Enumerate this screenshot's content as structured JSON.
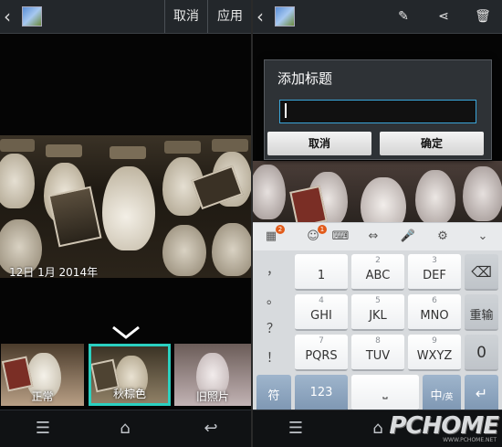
{
  "left_panel": {
    "actionbar": {
      "cancel_label": "取消",
      "apply_label": "应用"
    },
    "photo": {
      "date_text": "12日 1月 2014年"
    },
    "filters": [
      {
        "label": "正常",
        "selected": false
      },
      {
        "label": "秋棕色",
        "selected": true
      },
      {
        "label": "旧照片",
        "selected": false
      }
    ]
  },
  "right_panel": {
    "dialog": {
      "title": "添加标题",
      "input_value": "",
      "cancel_label": "取消",
      "ok_label": "确定"
    },
    "keyboard": {
      "toolbar_badges": {
        "apps": "2",
        "emoji": "1"
      },
      "symbols": [
        "，",
        "。",
        "？",
        "！"
      ],
      "rows": [
        [
          {
            "sub": "",
            "main": "1"
          },
          {
            "sub": "2",
            "main": "ABC"
          },
          {
            "sub": "3",
            "main": "DEF"
          }
        ],
        [
          {
            "sub": "4",
            "main": "GHI"
          },
          {
            "sub": "5",
            "main": "JKL"
          },
          {
            "sub": "6",
            "main": "MNO"
          }
        ],
        [
          {
            "sub": "7",
            "main": "PQRS"
          },
          {
            "sub": "8",
            "main": "TUV"
          },
          {
            "sub": "9",
            "main": "WXYZ"
          }
        ]
      ],
      "enter_label": "重输",
      "zero_label": "0",
      "symbol_key_label": "符",
      "num_key_label": "123",
      "lang_key_main": "中",
      "lang_key_sub": "/英"
    }
  },
  "watermark": {
    "main": "PCHOME",
    "sub": "WWW.PCHOME.NET"
  },
  "colors": {
    "accent": "#2bd0c0",
    "sepia": "#8a7a62",
    "blue_key": "#8aa3bf"
  }
}
